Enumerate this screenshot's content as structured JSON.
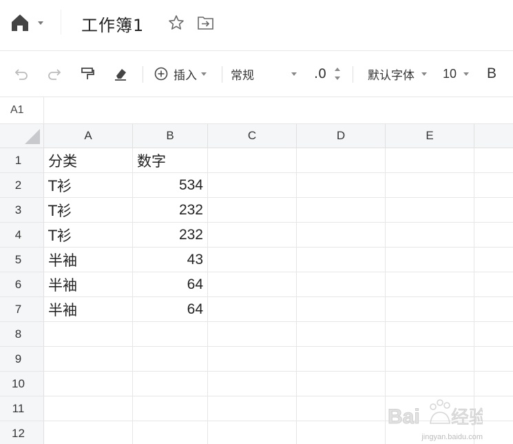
{
  "titlebar": {
    "title": "工作簿1"
  },
  "toolbar": {
    "insert_label": "插入",
    "format_value": "常规",
    "decimal_label": ".0",
    "font_value": "默认字体",
    "size_value": "10",
    "bold_label": "B"
  },
  "formula_bar": {
    "cell_ref": "A1"
  },
  "sheet": {
    "columns": [
      "A",
      "B",
      "C",
      "D",
      "E"
    ],
    "rows": [
      {
        "n": "1",
        "a": "分类",
        "b": "数字"
      },
      {
        "n": "2",
        "a": "T衫",
        "b": "534"
      },
      {
        "n": "3",
        "a": "T衫",
        "b": "232"
      },
      {
        "n": "4",
        "a": "T衫",
        "b": "232"
      },
      {
        "n": "5",
        "a": "半袖",
        "b": "43"
      },
      {
        "n": "6",
        "a": "半袖",
        "b": "64"
      },
      {
        "n": "7",
        "a": "半袖",
        "b": "64"
      },
      {
        "n": "8",
        "a": "",
        "b": ""
      },
      {
        "n": "9",
        "a": "",
        "b": ""
      },
      {
        "n": "10",
        "a": "",
        "b": ""
      },
      {
        "n": "11",
        "a": "",
        "b": ""
      },
      {
        "n": "12",
        "a": "",
        "b": ""
      }
    ]
  },
  "watermark": {
    "brand": "Bai经验",
    "url": "jingyan.baidu.com"
  }
}
